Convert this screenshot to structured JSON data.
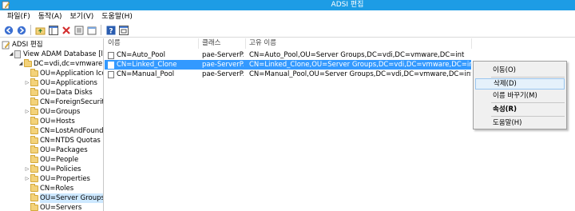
{
  "window": {
    "title": "ADSI 편집"
  },
  "menu": [
    "파일(F)",
    "동작(A)",
    "보기(V)",
    "도움말(H)"
  ],
  "toolbar": [
    "back-icon",
    "forward-icon",
    "up-folder-icon",
    "show-hide-tree-icon",
    "delete-icon",
    "properties-icon",
    "export-icon",
    "help-icon",
    "panel-icon"
  ],
  "tree": {
    "root": "ADSI 편집",
    "db": "View ADAM Database [loca",
    "dc": "DC=vdi,dc=vmware,dc=",
    "items": [
      "OU=Application Icon",
      "OU=Applications",
      "OU=Data Disks",
      "CN=ForeignSecurityP",
      "OU=Groups",
      "OU=Hosts",
      "CN=LostAndFound",
      "CN=NTDS Quotas",
      "OU=Packages",
      "OU=People",
      "OU=Policies",
      "OU=Properties",
      "CN=Roles",
      "OU=Server Groups",
      "OU=Servers"
    ]
  },
  "columns": [
    "이름",
    "클래스",
    "고유 이름"
  ],
  "rows": [
    {
      "name": "CN=Auto_Pool",
      "class": "pae-ServerP...",
      "dn": "CN=Auto_Pool,OU=Server Groups,DC=vdi,DC=vmware,DC=int"
    },
    {
      "name": "CN=Linked_Clone",
      "class": "pae-ServerP...",
      "dn": "CN=Linked_Clone,OU=Server Groups,DC=vdi,DC=vmware,DC=int"
    },
    {
      "name": "CN=Manual_Pool",
      "class": "pae-ServerP...",
      "dn": "CN=Manual_Pool,OU=Server Groups,DC=vdi,DC=vmware,DC=int"
    }
  ],
  "context_menu": [
    "이동(O)",
    "삭제(D)",
    "이름 바꾸기(M)",
    "속성(R)",
    "도움말(H)"
  ],
  "colors": {
    "titlebar": "#1d9ce5",
    "selection": "#3399ff"
  }
}
